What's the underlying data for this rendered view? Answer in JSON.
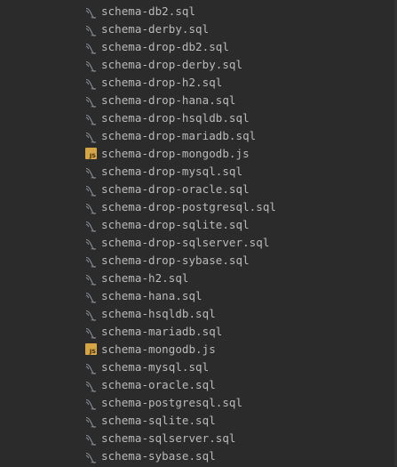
{
  "files": [
    {
      "name": "schema-db2.sql",
      "type": "sql",
      "icon": "sql-file-icon"
    },
    {
      "name": "schema-derby.sql",
      "type": "sql",
      "icon": "sql-file-icon"
    },
    {
      "name": "schema-drop-db2.sql",
      "type": "sql",
      "icon": "sql-file-icon"
    },
    {
      "name": "schema-drop-derby.sql",
      "type": "sql",
      "icon": "sql-file-icon"
    },
    {
      "name": "schema-drop-h2.sql",
      "type": "sql",
      "icon": "sql-file-icon"
    },
    {
      "name": "schema-drop-hana.sql",
      "type": "sql",
      "icon": "sql-file-icon"
    },
    {
      "name": "schema-drop-hsqldb.sql",
      "type": "sql",
      "icon": "sql-file-icon"
    },
    {
      "name": "schema-drop-mariadb.sql",
      "type": "sql",
      "icon": "sql-file-icon"
    },
    {
      "name": "schema-drop-mongodb.js",
      "type": "js",
      "icon": "js-file-icon",
      "badge": "JS"
    },
    {
      "name": "schema-drop-mysql.sql",
      "type": "sql",
      "icon": "sql-file-icon"
    },
    {
      "name": "schema-drop-oracle.sql",
      "type": "sql",
      "icon": "sql-file-icon"
    },
    {
      "name": "schema-drop-postgresql.sql",
      "type": "sql",
      "icon": "sql-file-icon"
    },
    {
      "name": "schema-drop-sqlite.sql",
      "type": "sql",
      "icon": "sql-file-icon"
    },
    {
      "name": "schema-drop-sqlserver.sql",
      "type": "sql",
      "icon": "sql-file-icon"
    },
    {
      "name": "schema-drop-sybase.sql",
      "type": "sql",
      "icon": "sql-file-icon"
    },
    {
      "name": "schema-h2.sql",
      "type": "sql",
      "icon": "sql-file-icon"
    },
    {
      "name": "schema-hana.sql",
      "type": "sql",
      "icon": "sql-file-icon"
    },
    {
      "name": "schema-hsqldb.sql",
      "type": "sql",
      "icon": "sql-file-icon"
    },
    {
      "name": "schema-mariadb.sql",
      "type": "sql",
      "icon": "sql-file-icon"
    },
    {
      "name": "schema-mongodb.js",
      "type": "js",
      "icon": "js-file-icon",
      "badge": "JS"
    },
    {
      "name": "schema-mysql.sql",
      "type": "sql",
      "icon": "sql-file-icon"
    },
    {
      "name": "schema-oracle.sql",
      "type": "sql",
      "icon": "sql-file-icon"
    },
    {
      "name": "schema-postgresql.sql",
      "type": "sql",
      "icon": "sql-file-icon"
    },
    {
      "name": "schema-sqlite.sql",
      "type": "sql",
      "icon": "sql-file-icon"
    },
    {
      "name": "schema-sqlserver.sql",
      "type": "sql",
      "icon": "sql-file-icon"
    },
    {
      "name": "schema-sybase.sql",
      "type": "sql",
      "icon": "sql-file-icon"
    }
  ],
  "colors": {
    "background": "#2b2b2b",
    "text": "#bbbbbb",
    "sql_icon": "#8a9199",
    "js_icon": "#d6a545"
  }
}
